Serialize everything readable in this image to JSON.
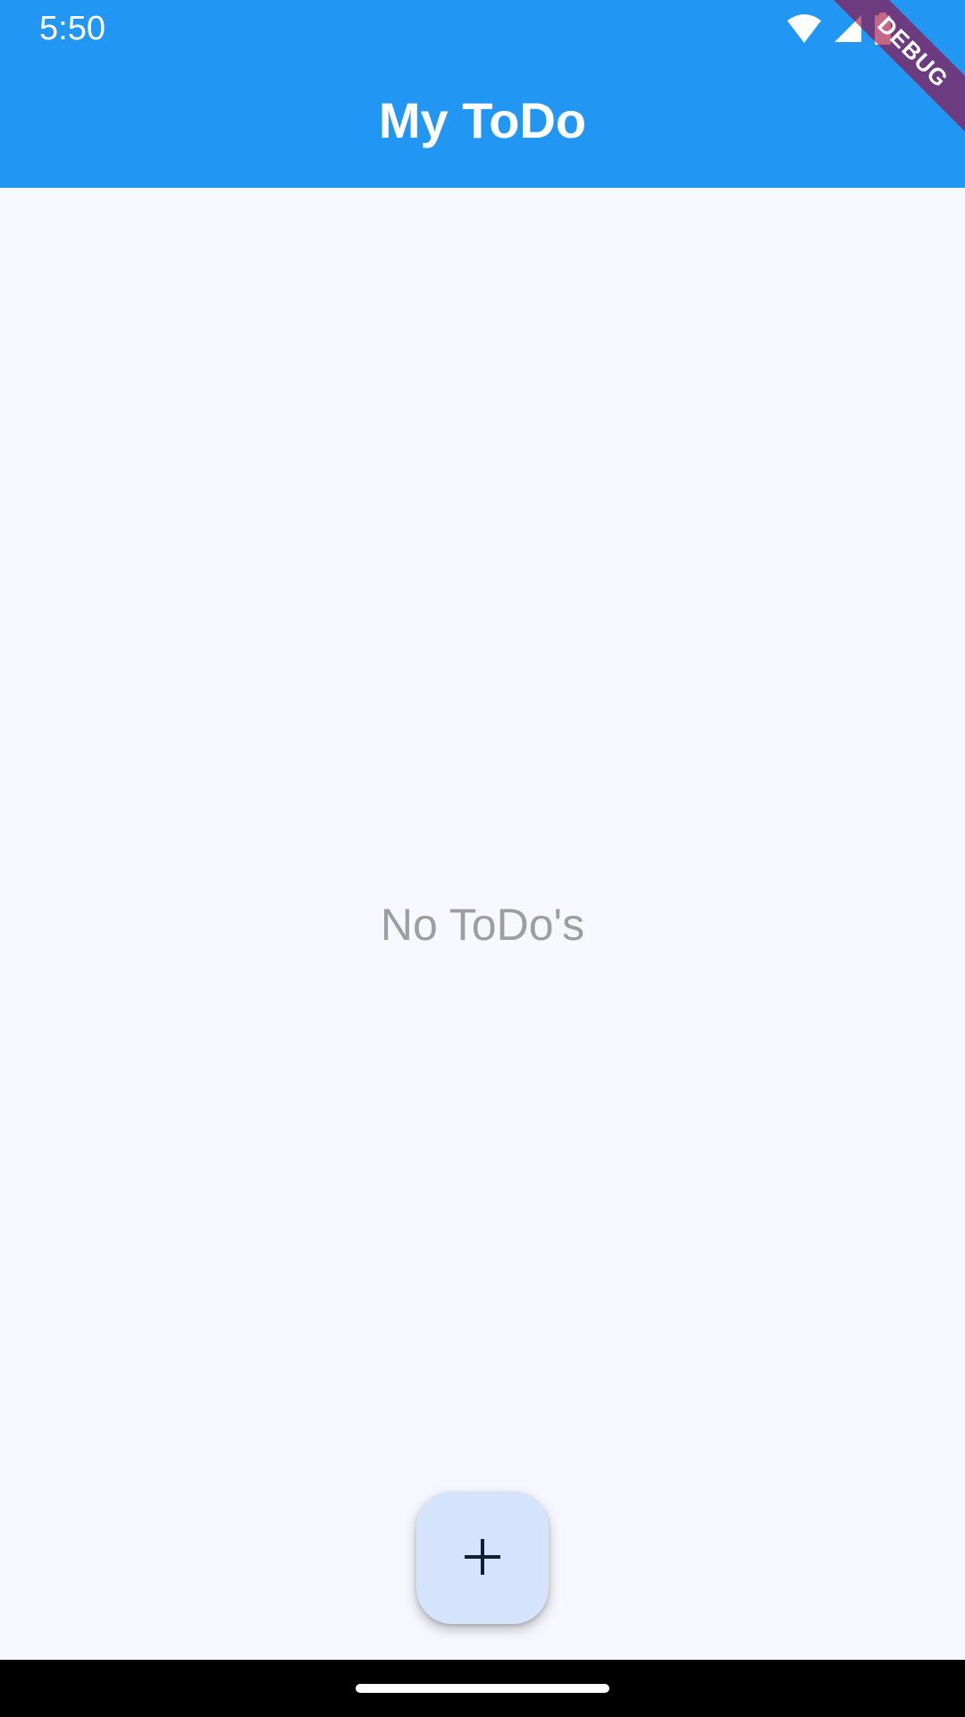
{
  "status_bar": {
    "time": "5:50",
    "icons": [
      "wifi-icon",
      "cellular-signal-icon",
      "battery-icon"
    ]
  },
  "app_bar": {
    "title": "My ToDo",
    "background_color": "#2196F3"
  },
  "debug_banner": {
    "label": "DEBUG"
  },
  "main": {
    "empty_message": "No ToDo's",
    "background_color": "#F7F8FF"
  },
  "fab": {
    "icon": "plus-icon",
    "background_color": "#D3E4FC"
  },
  "navigation_bar": {
    "handle": "home-indicator"
  }
}
